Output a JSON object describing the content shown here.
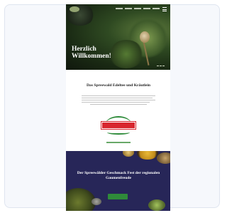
{
  "hero": {
    "title": "Herzlich Willkommen!"
  },
  "intro": {
    "title": "Das Spreewald Edeltee und Kräutlein"
  },
  "brand": {
    "logo_text": "Spreewald",
    "ribbon_color": "#d8262e",
    "arch_color": "#2e8b3a"
  },
  "feature": {
    "title": "Der Spreewälder Geschmack Fest der regionalen Gaumenfreude",
    "background": "#272658"
  },
  "colors": {
    "hero_dark": "#1a2a14",
    "cta_green": "#2f8a3a"
  }
}
